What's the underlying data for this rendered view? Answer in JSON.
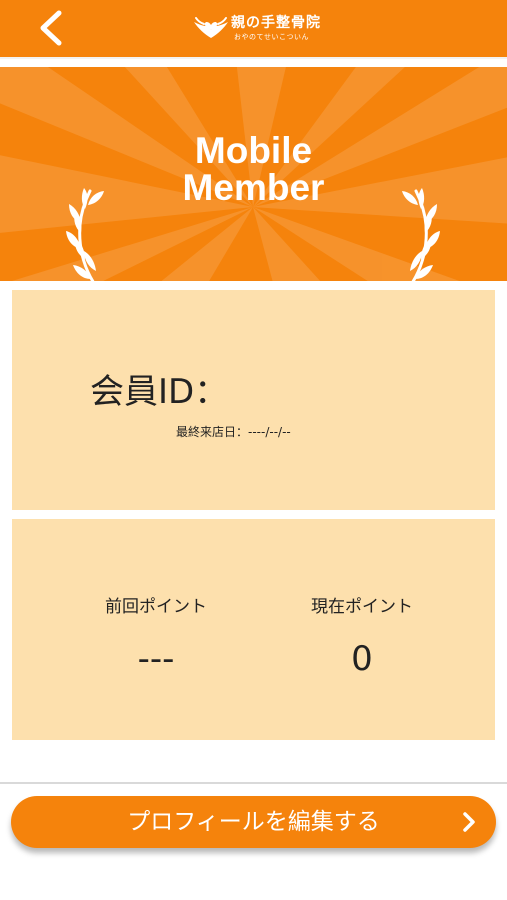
{
  "header": {
    "back_icon": "chevron-left-icon",
    "logo_name": "親の手整骨院",
    "logo_sub": "おやのてせいこついん"
  },
  "banner": {
    "title_line1": "Mobile",
    "title_line2": "Member",
    "left_icon": "laurel-left-icon",
    "right_icon": "laurel-right-icon"
  },
  "member_card": {
    "id_label": "会員ID：",
    "last_visit_label": "最終来店日：",
    "last_visit_value": "----/--/--"
  },
  "points_card": {
    "previous_label": "前回ポイント",
    "previous_value": "---",
    "current_label": "現在ポイント",
    "current_value": "0"
  },
  "profile_button": {
    "label": "プロフィールを編集する",
    "icon": "chevron-right-icon"
  },
  "colors": {
    "accent": "#f5830c",
    "card": "#fde0ad",
    "text": "#222222"
  }
}
